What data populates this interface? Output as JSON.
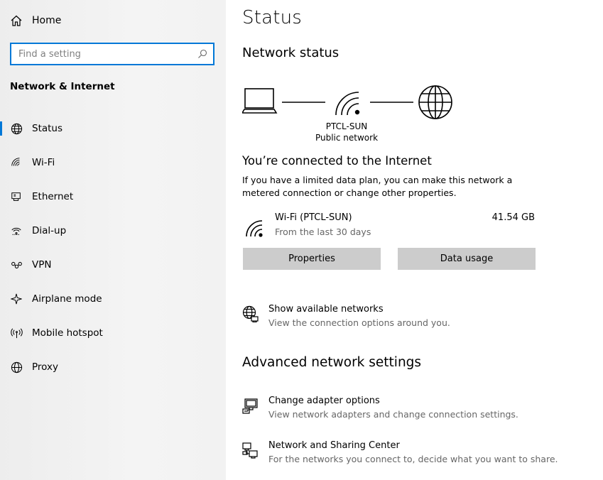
{
  "sidebar": {
    "home_label": "Home",
    "search_placeholder": "Find a setting",
    "section_title": "Network & Internet",
    "items": [
      {
        "label": "Status",
        "icon": "globe-icon",
        "active": true
      },
      {
        "label": "Wi-Fi",
        "icon": "wifi-icon"
      },
      {
        "label": "Ethernet",
        "icon": "ethernet-icon"
      },
      {
        "label": "Dial-up",
        "icon": "dialup-icon"
      },
      {
        "label": "VPN",
        "icon": "vpn-icon"
      },
      {
        "label": "Airplane mode",
        "icon": "airplane-icon"
      },
      {
        "label": "Mobile hotspot",
        "icon": "hotspot-icon"
      },
      {
        "label": "Proxy",
        "icon": "proxy-globe-icon"
      }
    ]
  },
  "main": {
    "title": "Status",
    "network_status_heading": "Network status",
    "network_name": "PTCL-SUN",
    "network_type": "Public network",
    "connected_title": "You’re connected to the Internet",
    "connected_desc": "If you have a limited data plan, you can make this network a metered connection or change other properties.",
    "connection": {
      "name": "Wi-Fi (PTCL-SUN)",
      "period": "From the last 30 days",
      "usage": "41.54 GB"
    },
    "buttons": {
      "properties": "Properties",
      "data_usage": "Data usage"
    },
    "show_networks": {
      "title": "Show available networks",
      "desc": "View the connection options around you."
    },
    "advanced_heading": "Advanced network settings",
    "adapter": {
      "title": "Change adapter options",
      "desc": "View network adapters and change connection settings."
    },
    "sharing": {
      "title": "Network and Sharing Center",
      "desc": "For the networks you connect to, decide what you want to share."
    }
  },
  "colors": {
    "accent": "#0078d7",
    "button_bg": "#cccccc",
    "sidebar_bg": "#f2f2f2",
    "secondary_text": "#666666"
  }
}
